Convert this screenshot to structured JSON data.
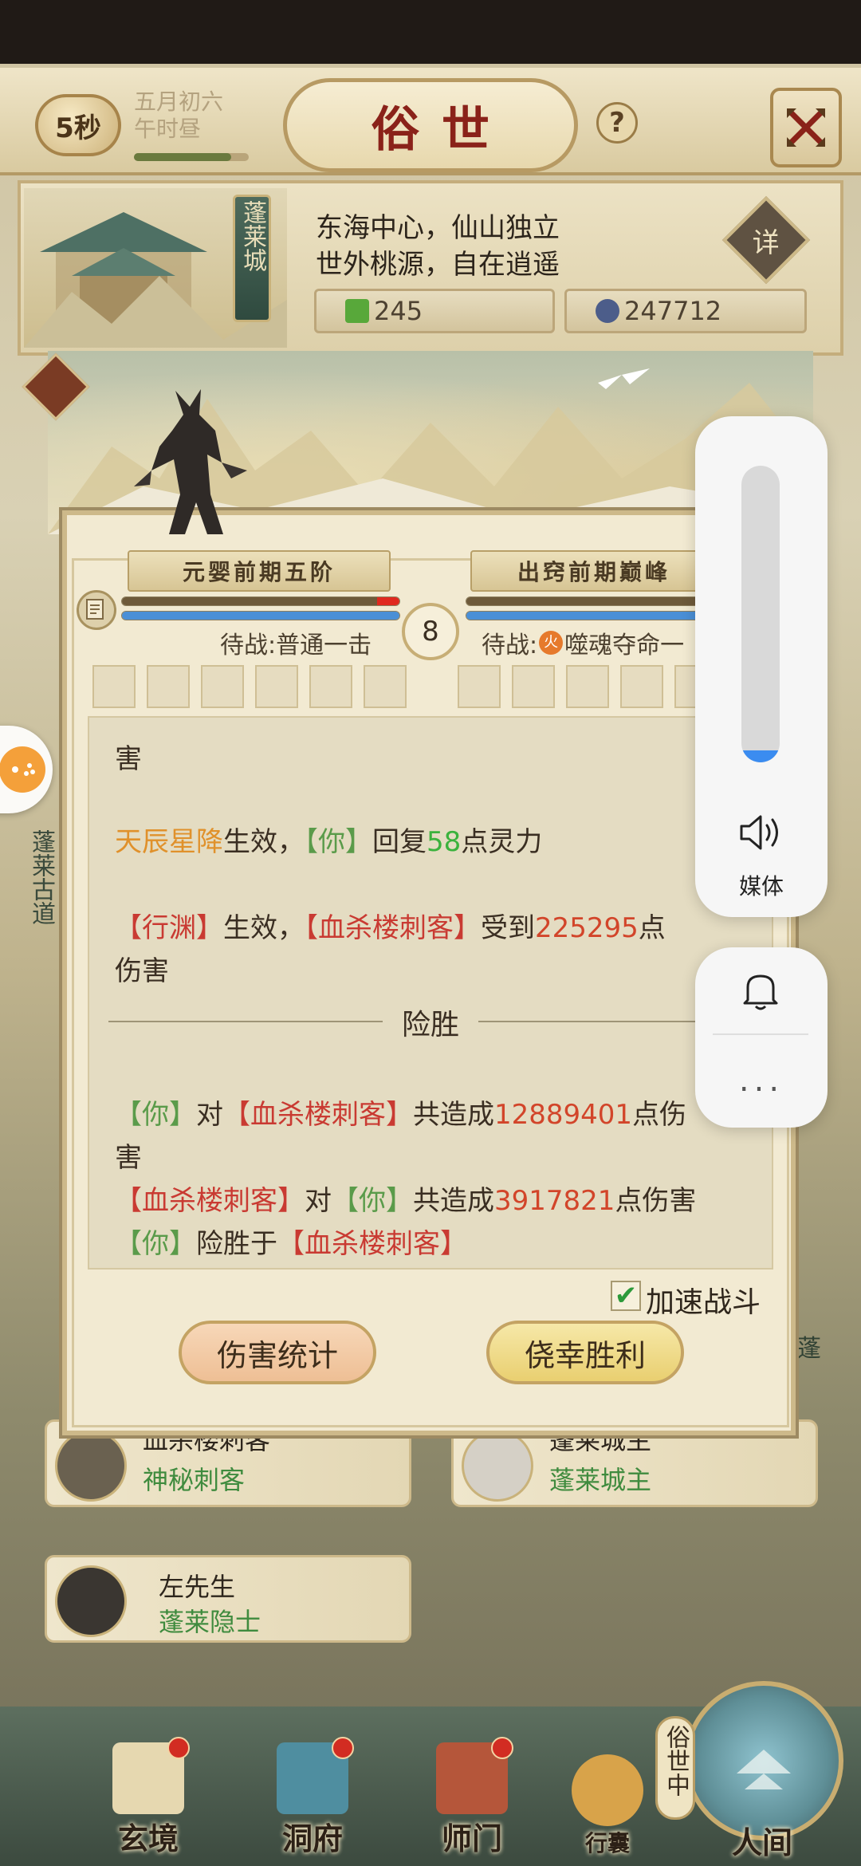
{
  "header": {
    "timer": "5秒",
    "date": "五月初六",
    "time_period": "午时昼",
    "date_progress": 0.85,
    "title": "俗世",
    "help_label": "?"
  },
  "location": {
    "city_banner": "蓬莱城",
    "desc_line_1": "东海中心，仙山独立",
    "desc_line_2": "世外桃源，自在逍遥",
    "detail_label": "详",
    "jade_amount": "245",
    "coin_amount": "247712"
  },
  "battle": {
    "player_realm": "元婴前期五阶",
    "enemy_realm": "出窍前期巅峰",
    "round": "8",
    "player_hp": 0.93,
    "player_mp": 1.0,
    "enemy_hp": 1.0,
    "enemy_mp": 1.0,
    "player_wait": "待战:普通一击",
    "enemy_wait_prefix": "待战:",
    "enemy_wait_element": "火",
    "enemy_wait_skill": "噬魂夺命一",
    "log": {
      "line_0": "害",
      "line_1_skill": "天辰星降",
      "line_1_mid": "生效，",
      "line_1_you": "【你】",
      "line_1_pre": "回复",
      "line_1_num": "58",
      "line_1_post": "点灵力",
      "line_2_skill": "【行渊】",
      "line_2_mid": "生效，",
      "line_2_enemy": "【血杀楼刺客】",
      "line_2_pre": "受到",
      "line_2_num": "225295",
      "line_2_post": "点",
      "line_3": "伤害",
      "result_divider": "险胜",
      "line_4_you": "【你】",
      "line_4_dui": "对",
      "line_4_enemy": "【血杀楼刺客】",
      "line_4_pre": "共造成",
      "line_4_num": "12889401",
      "line_4_post": "点伤",
      "line_5": "害",
      "line_6_enemy": "【血杀楼刺客】",
      "line_6_dui": "对",
      "line_6_you": "【你】",
      "line_6_pre": "共造成",
      "line_6_num": "3917821",
      "line_6_post": "点伤害",
      "line_7_you": "【你】",
      "line_7_mid": "险胜于",
      "line_7_enemy": "【血杀楼刺客】"
    },
    "speed_checked": "✔",
    "speed_label": "加速战斗",
    "damage_button": "伤害统计",
    "victory_button": "侥幸胜利"
  },
  "npcs": [
    {
      "name": "血杀楼刺客",
      "role": "神秘刺客"
    },
    {
      "name": "蓬莱城主",
      "role": "蓬莱城主"
    },
    {
      "name": "左先生",
      "role": "蓬莱隐士"
    }
  ],
  "side": {
    "path_label": "蓬莱古道",
    "right_tag": "蓬"
  },
  "nav": {
    "items": [
      "玄境",
      "洞府",
      "师门",
      "行囊",
      "人间"
    ],
    "world_tag": "俗世中"
  },
  "volume": {
    "level": 0.04,
    "media_label": "媒体",
    "more_label": "..."
  },
  "colors": {
    "accent_red": "#8a2219",
    "hp_red": "#e0291f",
    "mp_blue": "#4a8fd6",
    "role_green": "#3f8b3e",
    "volume_blue": "#3b8cf0"
  }
}
